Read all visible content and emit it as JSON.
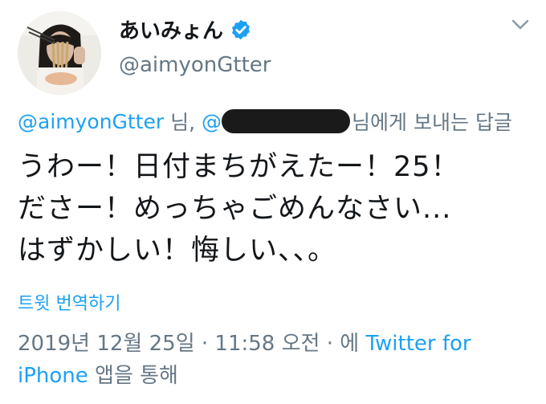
{
  "author": {
    "display_name": "あいみょん",
    "handle": "@aimyonGtter",
    "verified": true
  },
  "reply_context": {
    "mention_1": "@aimyonGtter",
    "suffix_1": " 님, ",
    "mention_2": "@",
    "suffix_2": "님에게 보내는 답글"
  },
  "tweet": {
    "line_1": "うわー！日付まちがえたー！25！",
    "line_2": "ださー！めっちゃごめんなさい...",
    "line_3": "はずかしい！悔しい、、。"
  },
  "translate_label": "트윗 번역하기",
  "meta": {
    "timestamp": "2019년 12월 25일 · 11:58 오전 · 에 ",
    "source_line_1": "Twitter for",
    "source_line_2": "iPhone",
    "suffix": " 앱을 통해"
  },
  "colors": {
    "link": "#1da1f2",
    "secondary": "#657786",
    "text": "#14171a"
  },
  "icons": {
    "verified": "verified-badge-icon",
    "menu": "chevron-down-icon"
  }
}
